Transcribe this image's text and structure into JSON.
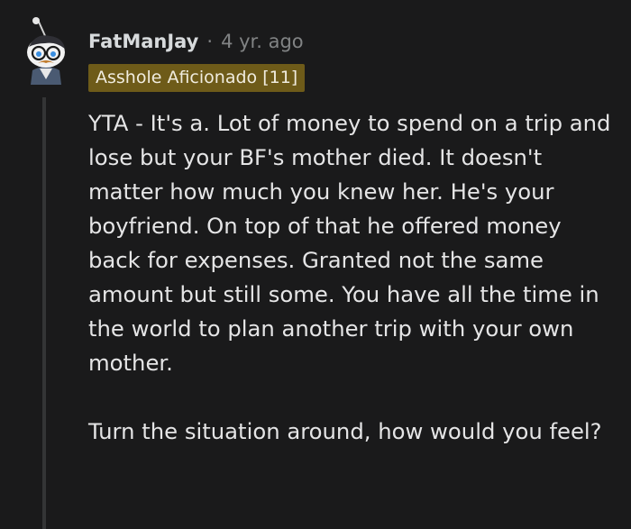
{
  "comment": {
    "username": "FatManJay",
    "separator": "·",
    "time": "4 yr. ago",
    "flair": "Asshole Aficionado [11]",
    "paragraphs": [
      "YTA - It's a. Lot of money to spend on a trip and lose but your BF's mother died. It doesn't matter how much you knew her. He's your boyfriend. On top of that he offered money back for expenses. Granted not the same amount but still some. You have all the time in the world to plan another trip with your own mother.",
      "Turn the situation around, how would you feel?"
    ],
    "avatar_icon": "snoo-avatar-icon"
  },
  "colors": {
    "background": "#1a1a1b",
    "text": "#d7dadc",
    "meta": "#818384",
    "flair_bg": "#6e5b19",
    "thread_line": "#343536"
  }
}
